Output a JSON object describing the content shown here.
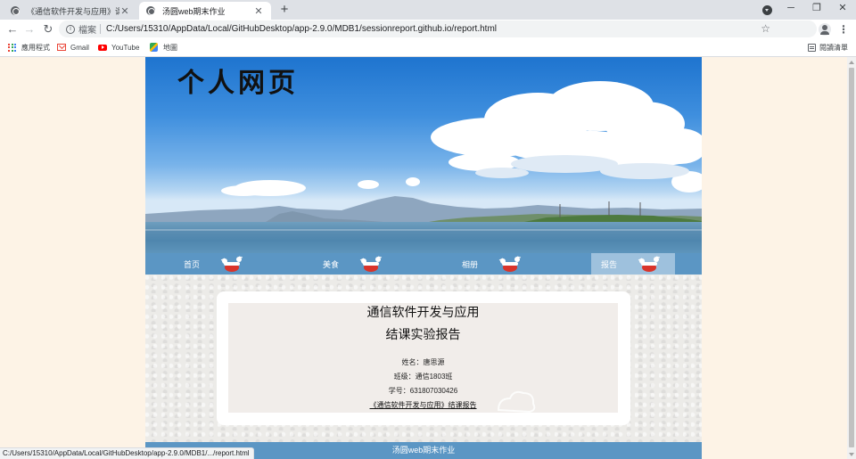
{
  "browser": {
    "tabs": [
      {
        "title": "《通信软件开发与应用》课程结",
        "active": false,
        "close": "✕"
      },
      {
        "title": "汤圆web期末作业",
        "active": true,
        "close": "✕"
      }
    ],
    "new_tab": "+",
    "window_controls": {
      "minimize": "─",
      "maximize": "❐",
      "close": "✕"
    },
    "nav": {
      "back": "←",
      "forward": "→",
      "reload": "↻"
    },
    "address": {
      "info_icon": "i",
      "scheme_label": "檔案",
      "url": "C:/Users/15310/AppData/Local/GitHubDesktop/app-2.9.0/MDB1/sessionreport.github.io/report.html"
    },
    "star_icon": "☆",
    "menu_icon": "⋮",
    "bookmarks": [
      {
        "label": "應用程式",
        "icon": "apps-icon"
      },
      {
        "label": "Gmail",
        "icon": "gmail-icon"
      },
      {
        "label": "YouTube",
        "icon": "youtube-icon"
      },
      {
        "label": "地圖",
        "icon": "maps-icon"
      }
    ],
    "reading_list": "閱讀清單",
    "status_url": "C:/Users/15310/AppData/Local/GitHubDesktop/app-2.9.0/MDB1/.../report.html"
  },
  "page": {
    "site_title": "个人网页",
    "nav": [
      {
        "label": "首页",
        "active": false
      },
      {
        "label": "美食",
        "active": false
      },
      {
        "label": "相册",
        "active": false
      },
      {
        "label": "报告",
        "active": true
      }
    ],
    "report": {
      "title_line1": "通信软件开发与应用",
      "title_line2": "结课实验报告",
      "name": "姓名：唐思源",
      "class": "班级：通信1803班",
      "student_id": "学号：631807030426",
      "link": "《通信软件开发与应用》结课报告"
    },
    "footer": "汤圆web期末作业"
  },
  "colors": {
    "nav_bar": "#5b96c4",
    "nav_active": "#9ec1dd",
    "page_bg": "#fdf3e6",
    "footer": "#5b96c4"
  }
}
